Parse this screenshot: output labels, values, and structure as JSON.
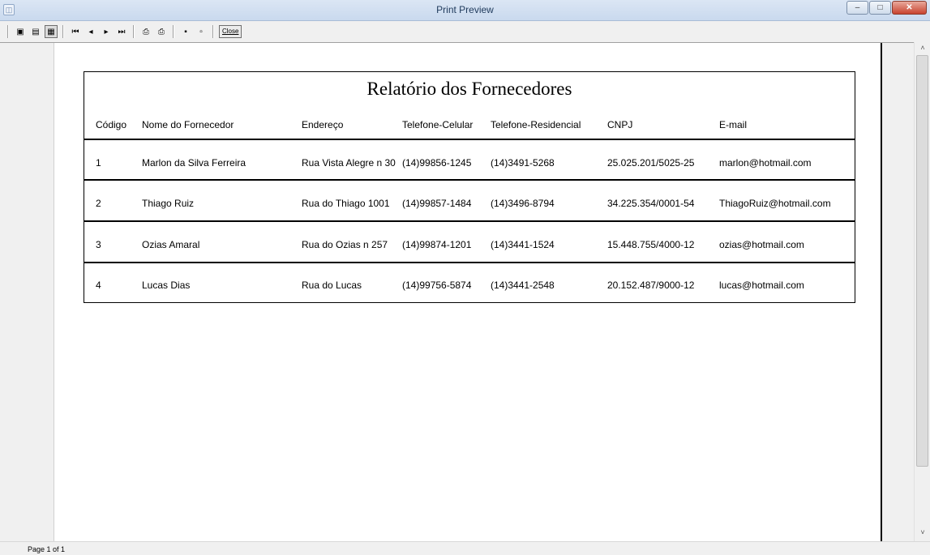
{
  "window": {
    "title": "Print Preview",
    "minimize_glyph": "–",
    "maximize_glyph": "□",
    "close_glyph": "✕"
  },
  "toolbar": {
    "close_label": "Close",
    "glyphs": {
      "one_page": "▣",
      "two_pages": "▤",
      "page_width": "▦",
      "first": "⏮",
      "prev": "◂",
      "next": "▸",
      "last": "⏭",
      "print_setup": "⎙",
      "print": "⎙",
      "save": "▪",
      "open": "▫"
    }
  },
  "report": {
    "title": "Relatório dos Fornecedores",
    "columns": [
      "Código",
      "Nome do Fornecedor",
      "Endereço",
      "Telefone-Celular",
      "Telefone-Residencial",
      "CNPJ",
      "E-mail"
    ],
    "rows": [
      [
        "1",
        "Marlon da Silva Ferreira",
        "Rua Vista Alegre n 30",
        "(14)99856-1245",
        "(14)3491-5268",
        "25.025.201/5025-25",
        "marlon@hotmail.com"
      ],
      [
        "2",
        "Thiago Ruiz",
        "Rua do Thiago 1001",
        "(14)99857-1484",
        "(14)3496-8794",
        "34.225.354/0001-54",
        "ThiagoRuiz@hotmail.com"
      ],
      [
        "3",
        "Ozias Amaral",
        "Rua do Ozias n 257",
        "(14)99874-1201",
        "(14)3441-1524",
        "15.448.755/4000-12",
        "ozias@hotmail.com"
      ],
      [
        "4",
        "Lucas Dias",
        "Rua do Lucas",
        "(14)99756-5874",
        "(14)3441-2548",
        "20.152.487/9000-12",
        "lucas@hotmail.com"
      ]
    ]
  },
  "scrollbar": {
    "up_glyph": "˄",
    "down_glyph": "˅"
  },
  "status": {
    "page_info": "Page 1 of 1"
  },
  "colors": {
    "titlebar": "#c9d9ee",
    "close_button": "#c8432f",
    "page": "#ffffff"
  }
}
